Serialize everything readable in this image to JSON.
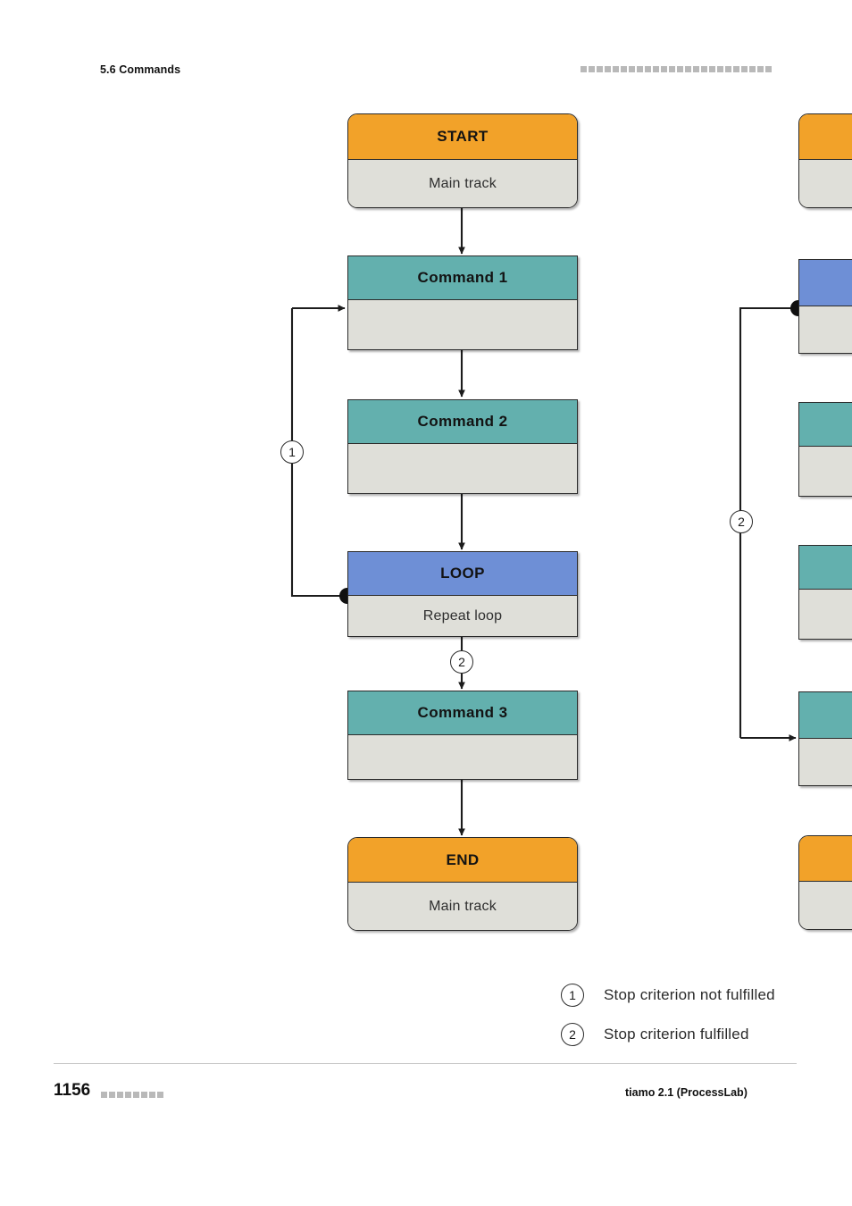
{
  "page": {
    "header": {
      "section_label": "5.6 Commands",
      "redacted_block_count": 24
    },
    "footer": {
      "page_number": "1156",
      "redacted_block_count": 8,
      "product": "tiamo 2.1 (ProcessLab)"
    }
  },
  "colors": {
    "terminal_header": "#f2a229",
    "command_header": "#63b0ae",
    "loop_header": "#6e8fd6",
    "box_body": "#dfdfd9",
    "outline": "#2b2b2b",
    "redact": "#b9b9b9"
  },
  "diagram": {
    "left_flow": {
      "nodes": [
        {
          "id": "start",
          "title": "START",
          "subtitle": "Main track",
          "type": "terminal",
          "shape": "rounded"
        },
        {
          "id": "command1",
          "title": "Command 1",
          "subtitle": "",
          "type": "command",
          "shape": "square"
        },
        {
          "id": "command2",
          "title": "Command 2",
          "subtitle": "",
          "type": "command",
          "shape": "square"
        },
        {
          "id": "loop",
          "title": "LOOP",
          "subtitle": "Repeat loop",
          "type": "loop",
          "shape": "square"
        },
        {
          "id": "command3",
          "title": "Command 3",
          "subtitle": "",
          "type": "command",
          "shape": "square"
        },
        {
          "id": "end",
          "title": "END",
          "subtitle": "Main track",
          "type": "terminal",
          "shape": "rounded"
        }
      ],
      "markers": {
        "loopback": "1",
        "exit": "2"
      }
    },
    "right_flow": {
      "nodes": [
        {
          "id": "r-start",
          "type": "terminal",
          "shape": "rounded"
        },
        {
          "id": "r-loop",
          "type": "loop",
          "shape": "square"
        },
        {
          "id": "r-command1",
          "type": "command",
          "shape": "square"
        },
        {
          "id": "r-command2",
          "type": "command",
          "shape": "square"
        },
        {
          "id": "r-command3",
          "type": "command",
          "shape": "square"
        },
        {
          "id": "r-end",
          "type": "terminal",
          "shape": "rounded"
        }
      ],
      "markers": {
        "exit": "2"
      }
    }
  },
  "legend": {
    "items": [
      {
        "marker": "1",
        "text": "Stop criterion not fulfilled"
      },
      {
        "marker": "2",
        "text": "Stop criterion fulfilled"
      }
    ]
  }
}
